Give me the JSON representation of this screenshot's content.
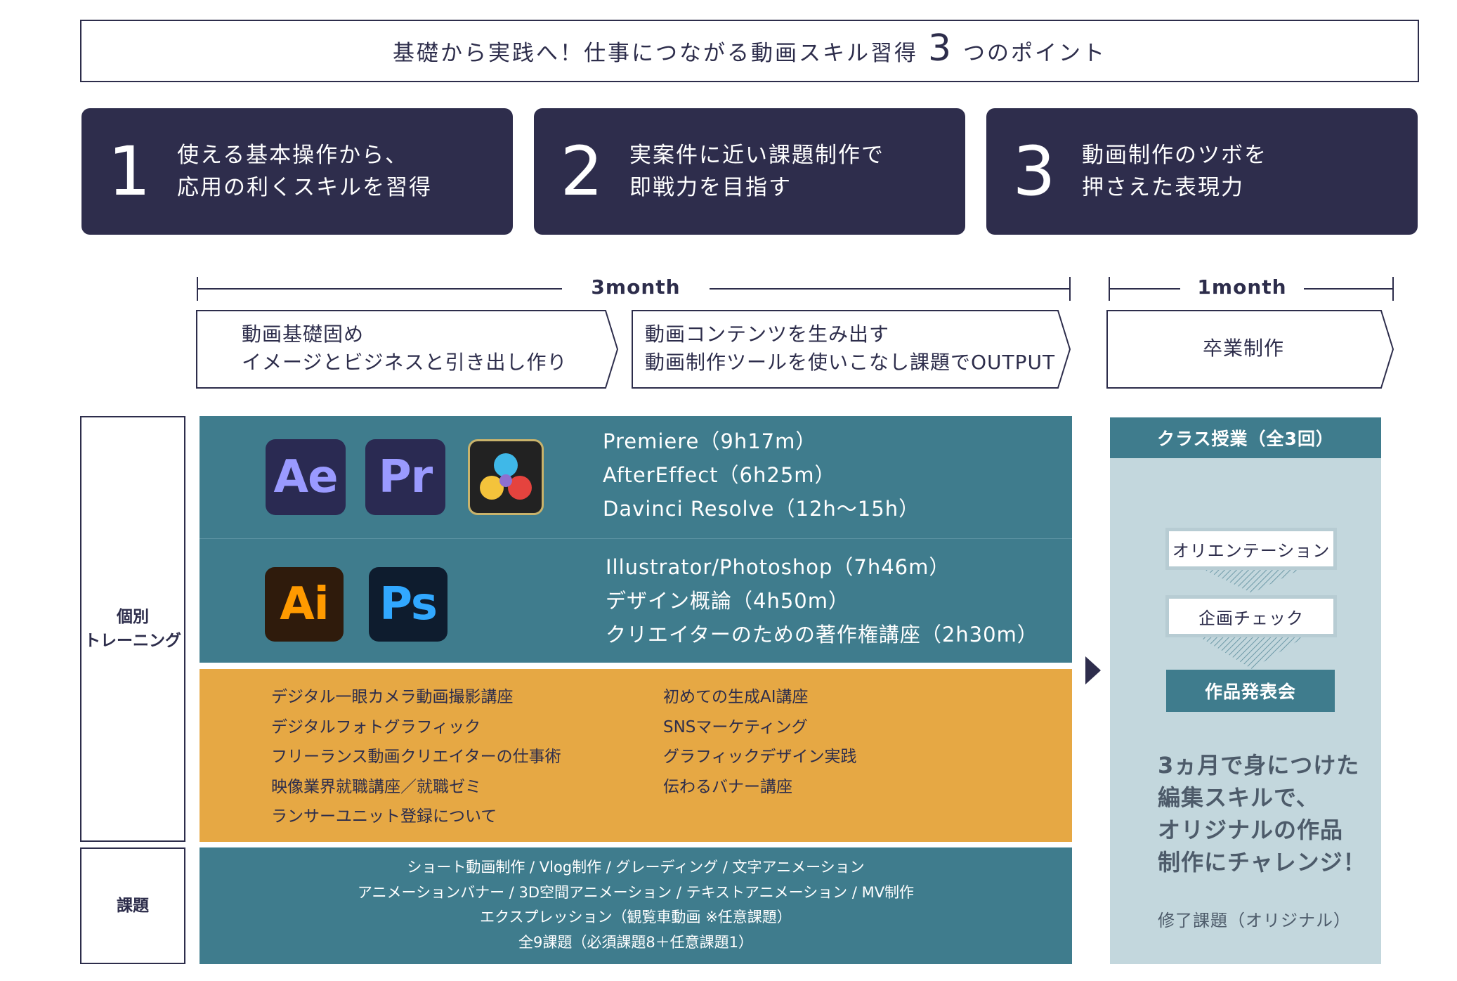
{
  "header": {
    "title_before": "基礎から実践へ！仕事につながる動画スキル習得",
    "title_number": "3",
    "title_after": "つのポイント"
  },
  "points": [
    {
      "number": "1",
      "line1": "使える基本操作から、",
      "line2": "応用の利くスキルを習得"
    },
    {
      "number": "2",
      "line1": "実案件に近い課題制作で",
      "line2": "即戦力を目指す"
    },
    {
      "number": "3",
      "line1": "動画制作のツボを",
      "line2": "押さえた表現力"
    }
  ],
  "timeline": {
    "phase_a_duration": "3month",
    "phase_b_duration": "1month"
  },
  "phases": [
    {
      "line1": "動画基礎固め",
      "line2": "イメージとビジネスと引き出し作り"
    },
    {
      "line1": "動画コンテンツを生み出す",
      "line2": "動画制作ツールを使いこなし課題でOUTPUT"
    },
    {
      "line1": "卒業制作",
      "line2": ""
    }
  ],
  "labels": {
    "individual_training": [
      "個別",
      "トレーニング"
    ],
    "assignments": "課題"
  },
  "video_apps": {
    "icons": [
      {
        "name": "after-effects-icon",
        "text": "Ae",
        "bg": "#2a2a52",
        "fg": "#9a9aff"
      },
      {
        "name": "premiere-icon",
        "text": "Pr",
        "bg": "#2a2a52",
        "fg": "#9a9aff"
      },
      {
        "name": "davinci-resolve-icon",
        "text": "",
        "bg": "#222222",
        "fg": "#ffffff"
      }
    ],
    "courses": [
      "Premiere（9h17m）",
      "AfterEffect（6h25m）",
      "Davinci Resolve（12h〜15h）"
    ]
  },
  "design_apps": {
    "icons": [
      {
        "name": "illustrator-icon",
        "text": "Ai",
        "bg": "#2f1b0c",
        "fg": "#ff9a00"
      },
      {
        "name": "photoshop-icon",
        "text": "Ps",
        "bg": "#0e1c2e",
        "fg": "#31a8ff"
      }
    ],
    "courses": [
      "Illustrator/Photoshop（7h46m）",
      "デザイン概論（4h50m）",
      "クリエイターのための著作権講座（2h30m）"
    ]
  },
  "extra_courses": {
    "left": [
      "デジタル一眼カメラ動画撮影講座",
      "デジタルフォトグラフィック",
      "フリーランス動画クリエイターの仕事術",
      "映像業界就職講座／就職ゼミ",
      "ランサーユニット登録について"
    ],
    "right": [
      "初めての生成AI講座",
      "SNSマーケティング",
      "グラフィックデザイン実践",
      "伝わるバナー講座"
    ]
  },
  "assignments": [
    "ショート動画制作 / Vlog制作 / グレーディング / 文字アニメーション",
    "アニメーションバナー / 3D空間アニメーション / テキストアニメーション / MV制作",
    "エクスプレッション（観覧車動画 ※任意課題）",
    "全9課題（必須課題8＋任意課題1）"
  ],
  "class_sessions": {
    "title": "クラス授業（全3回）",
    "steps": [
      "オリエンテーション",
      "企画チェック",
      "作品発表会"
    ],
    "message": [
      "3ヵ月で身につけた",
      "編集スキルで、",
      "オリジナルの作品",
      "制作にチャレンジ！"
    ],
    "footer": "修了課題（オリジナル）"
  },
  "colors": {
    "navy": "#2e2d4c",
    "teal": "#3f7c8d",
    "orange": "#e6a844",
    "light_teal": "#c3d7dd"
  }
}
